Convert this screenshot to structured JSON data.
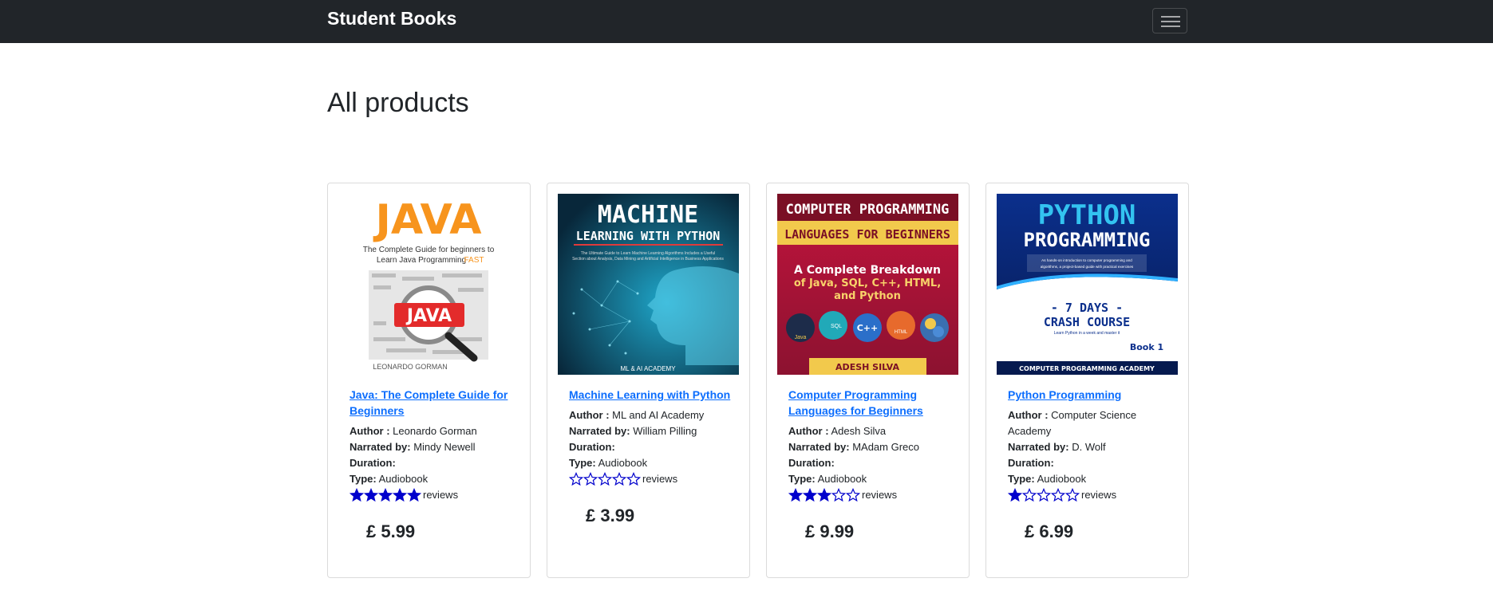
{
  "navbar": {
    "brand": "Student Books"
  },
  "page": {
    "title": "All products"
  },
  "labels": {
    "author": "Author :",
    "narrated": "Narrated by:",
    "duration": "Duration:",
    "type": "Type:",
    "reviews": "reviews"
  },
  "colors": {
    "star": "#0000cc",
    "link": "#0d6efd",
    "navbar": "#212529"
  },
  "products": [
    {
      "title": "Java: The Complete Guide for Beginners",
      "author": "Leonardo Gorman",
      "narrator": "Mindy Newell",
      "duration": "",
      "type": "Audiobook",
      "rating": 5,
      "price": "£ 5.99",
      "cover": {
        "title": "JAVA",
        "subtitle_1": "The Complete Guide for beginners to",
        "subtitle_2": "Learn Java Programming",
        "subtitle_highlight": "FAST",
        "badge": "JAVA",
        "author": "LEONARDO GORMAN"
      }
    },
    {
      "title": "Machine Learning with Python",
      "author": "ML and AI Academy",
      "narrator": "William Pilling",
      "duration": "",
      "type": "Audiobook",
      "rating": 0,
      "price": "£ 3.99",
      "cover": {
        "title_1": "MACHINE",
        "title_2": "LEARNING WITH PYTHON",
        "tagline_1": "The Ultimate Guide to Learn Machine Learning Algorithms Includes a Useful",
        "tagline_2": "Section about Analysis, Data Mining and Artificial Intelligence in Business Applications",
        "author": "ML & AI ACADEMY"
      }
    },
    {
      "title": "Computer Programming Languages for Beginners",
      "author": "Adesh Silva",
      "narrator": "MAdam Greco",
      "duration": "",
      "type": "Audiobook",
      "rating": 3,
      "price": "£ 9.99",
      "cover": {
        "title_1": "COMPUTER PROGRAMMING",
        "title_2": "LANGUAGES FOR BEGINNERS",
        "line_1": "A Complete Breakdown",
        "line_2": "of Java, SQL, C++, HTML,",
        "line_3": "and Python",
        "icon_java": "Java",
        "icon_sql": "SQL",
        "icon_cpp": "C++",
        "icon_html": "HTML",
        "author": "ADESH SILVA"
      }
    },
    {
      "title": "Python Programming",
      "author": "Computer Science Academy",
      "narrator": "D. Wolf",
      "duration": "",
      "type": "Audiobook",
      "rating": 1,
      "price": "£ 6.99",
      "cover": {
        "title_1": "PYTHON",
        "title_2": "PROGRAMMING",
        "blurb_1": "As hands-on introduction to computer programming and",
        "blurb_2": "algorithms, a project-based guide with practical exercises",
        "days": "- 7 DAYS -",
        "crash": "CRASH COURSE",
        "learn": "Learn Python in a week and master it",
        "book": "Book 1",
        "footer": "COMPUTER PROGRAMMING ACADEMY"
      }
    }
  ]
}
